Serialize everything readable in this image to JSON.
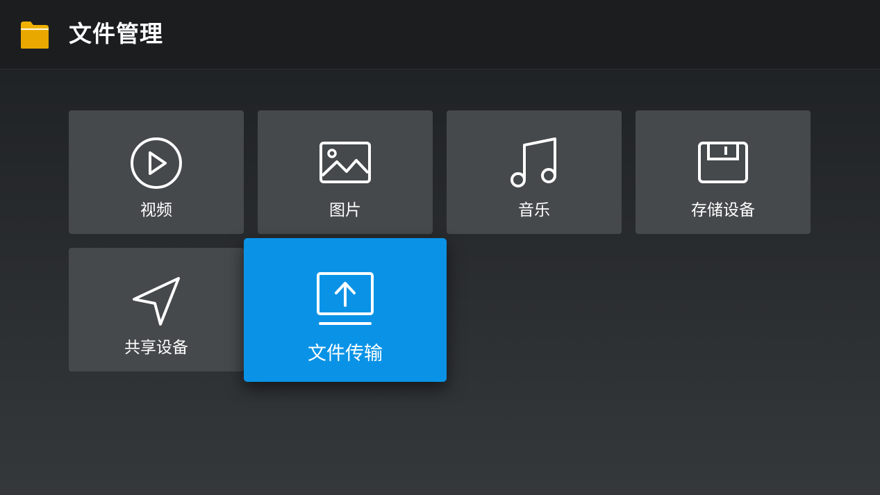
{
  "header": {
    "title": "文件管理",
    "icon": "folder-icon"
  },
  "tiles": [
    {
      "label": "视频",
      "icon": "play-circle-icon"
    },
    {
      "label": "图片",
      "icon": "image-icon"
    },
    {
      "label": "音乐",
      "icon": "music-note-icon"
    },
    {
      "label": "存储设备",
      "icon": "floppy-disk-icon"
    },
    {
      "label": "共享设备",
      "icon": "send-arrow-icon"
    },
    {
      "label": "文件传输",
      "icon": "monitor-upload-icon",
      "focused": true
    }
  ],
  "colors": {
    "accent": "#0a93e6",
    "tile": "#45494b",
    "folder": "#f0b100",
    "header": "#1b1d1f"
  }
}
